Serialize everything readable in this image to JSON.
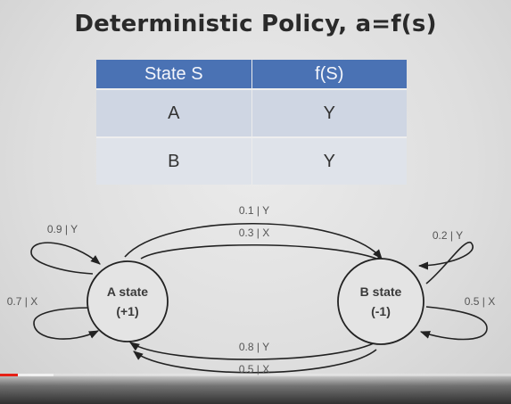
{
  "title": "Deterministic Policy, a=f(s)",
  "table": {
    "headers": [
      "State S",
      "f(S)"
    ],
    "rows": [
      [
        "A",
        "Y"
      ],
      [
        "B",
        "Y"
      ]
    ],
    "header_color": "#4a72b4"
  },
  "diagram": {
    "nodes": [
      {
        "line1": "A state",
        "line2": "(+1)"
      },
      {
        "line1": "B state",
        "line2": "(-1)"
      }
    ],
    "edges": {
      "a_to_b_top": "0.1 | Y",
      "a_to_b_bottom": "0.3 | X",
      "a_self_top": "0.9 | Y",
      "a_self_bottom": "0.7 | X",
      "b_self_top": "0.2 | Y",
      "b_self_bottom": "0.5 | X",
      "b_to_a_top": "0.8 | Y",
      "b_to_a_bottom": "0.5 | X"
    }
  },
  "player": {
    "played_fraction": 0.035,
    "buffered_fraction": 0.105,
    "played_color": "#e62117"
  }
}
